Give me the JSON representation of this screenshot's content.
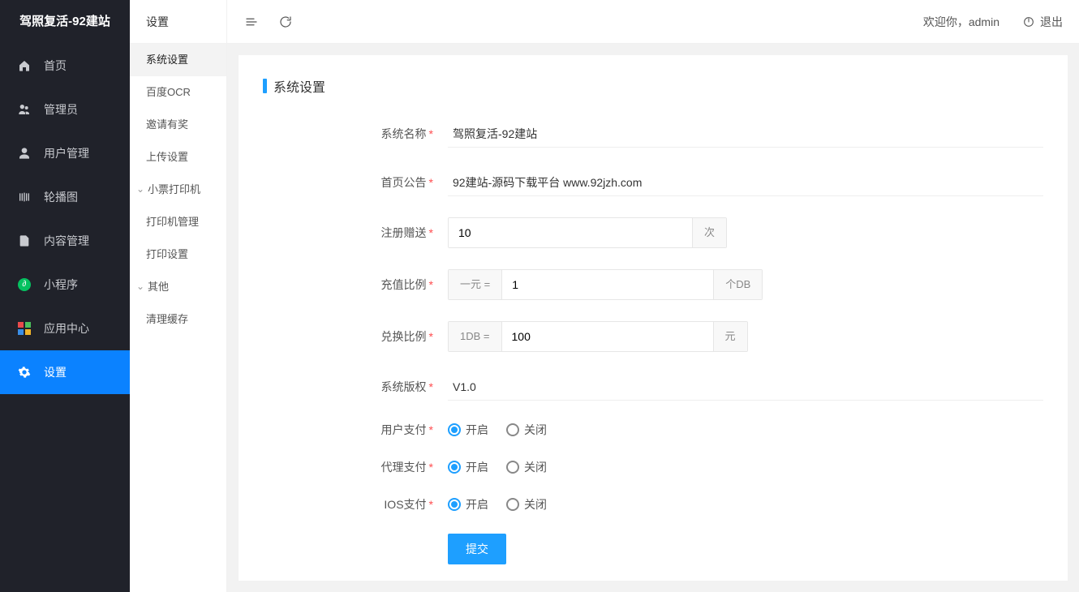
{
  "brand": "驾照复活-92建站",
  "topbar": {
    "welcome_prefix": "欢迎你，",
    "username": "admin",
    "logout": "退出"
  },
  "nav": {
    "home": "首页",
    "admin": "管理员",
    "users": "用户管理",
    "carousel": "轮播图",
    "content": "内容管理",
    "miniapp": "小程序",
    "appcenter": "应用中心",
    "settings": "设置"
  },
  "submenu": {
    "title": "设置",
    "system": "系统设置",
    "ocr": "百度OCR",
    "invite": "邀请有奖",
    "upload": "上传设置",
    "printer_group": "小票打印机",
    "printer_mgmt": "打印机管理",
    "print_settings": "打印设置",
    "other_group": "其他",
    "clear_cache": "清理缓存"
  },
  "panel": {
    "title": "系统设置"
  },
  "form": {
    "labels": {
      "sys_name": "系统名称",
      "home_notice": "首页公告",
      "register_gift": "注册赠送",
      "recharge_ratio": "充值比例",
      "exchange_ratio": "兑换比例",
      "copyright": "系统版权",
      "user_pay": "用户支付",
      "agent_pay": "代理支付",
      "ios_pay": "IOS支付"
    },
    "values": {
      "sys_name": "驾照复活-92建站",
      "home_notice": "92建站-源码下载平台 www.92jzh.com",
      "register_gift": "10",
      "recharge_ratio": "1",
      "exchange_ratio": "100",
      "copyright": "V1.0"
    },
    "addons": {
      "times": "次",
      "one_yuan_eq": "一元 =",
      "unit_db": "个DB",
      "one_db_eq": "1DB =",
      "yuan": "元"
    },
    "radio": {
      "on": "开启",
      "off": "关闭"
    },
    "submit": "提交"
  }
}
